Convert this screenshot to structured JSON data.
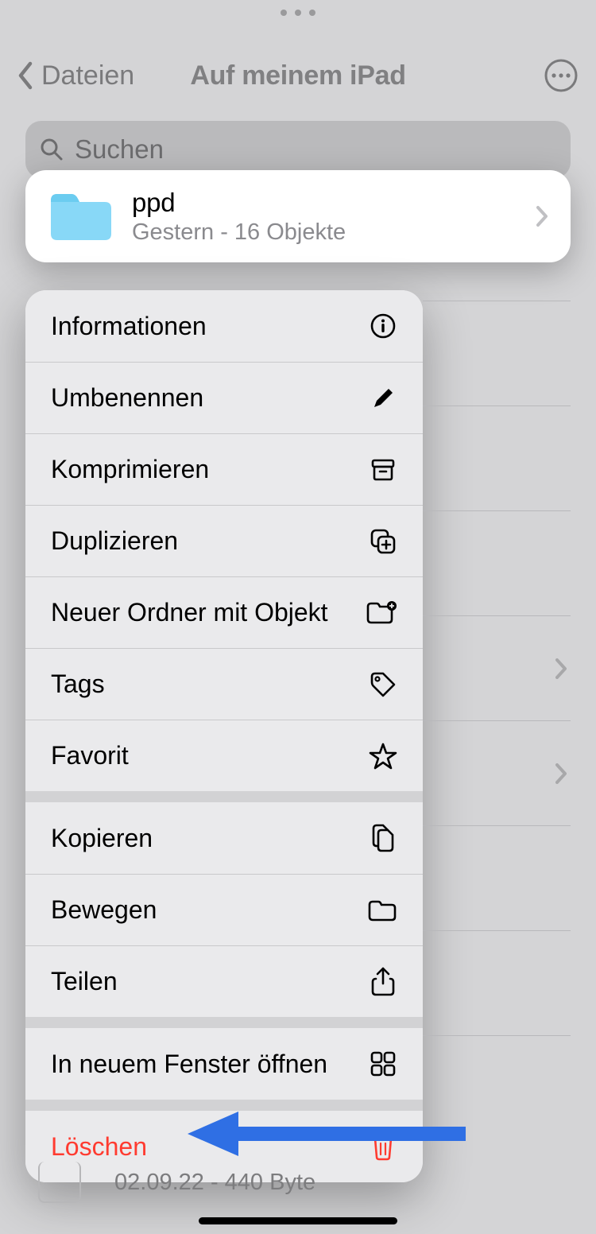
{
  "nav": {
    "back_label": "Dateien",
    "title": "Auf meinem iPad"
  },
  "search": {
    "placeholder": "Suchen"
  },
  "folder": {
    "name": "ppd",
    "subtitle": "Gestern - 16 Objekte"
  },
  "menu": {
    "info": "Informationen",
    "rename": "Umbenennen",
    "compress": "Komprimieren",
    "duplicate": "Duplizieren",
    "newfolder": "Neuer Ordner mit Objekt",
    "tags": "Tags",
    "favorite": "Favorit",
    "copy": "Kopieren",
    "move": "Bewegen",
    "share": "Teilen",
    "newwindow": "In neuem Fenster öffnen",
    "delete": "Löschen"
  },
  "bottom": {
    "subtitle": "02.09.22 - 440 Byte"
  }
}
